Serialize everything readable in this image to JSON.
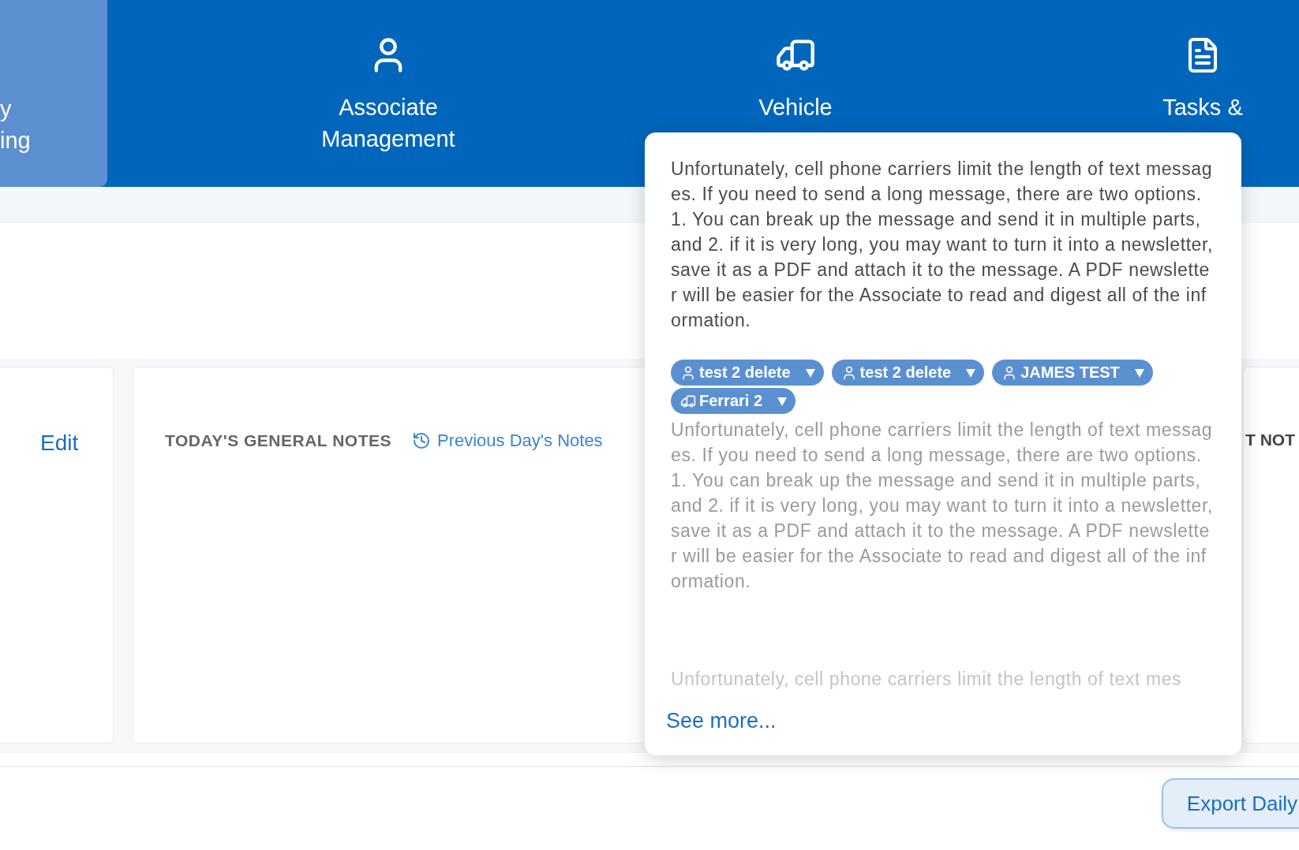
{
  "nav": {
    "tabs": [
      {
        "kind": "partial",
        "lines": [
          "y",
          "ing"
        ],
        "selected": true
      },
      {
        "kind": "associate",
        "lines": [
          "Associate",
          "Management"
        ],
        "selected": false
      },
      {
        "kind": "vehicle",
        "lines": [
          "Vehicle"
        ],
        "selected": false
      },
      {
        "kind": "tasks",
        "lines": [
          "Tasks &"
        ],
        "selected": false
      }
    ]
  },
  "left_card": {
    "edit_link": "Edit"
  },
  "general_notes_card": {
    "title": "TODAY'S GENERAL NOTES",
    "previous_link": "Previous Day's Notes"
  },
  "right_card": {
    "title_fragment": "T NOT"
  },
  "popover": {
    "entries": [
      {
        "kind": "dark",
        "text": "Unfortunately, cell phone carriers limit the length of text messages. If you need to send a long message, there are two options. 1. You can break up the message and send it in multiple parts, and 2. if it is very long, you may want to turn it into a newsletter, save it as a PDF and attach it to the message. A PDF newsletter will be easier for the Associate to read and digest all of the information."
      },
      {
        "kind": "muted",
        "tags": [
          {
            "kind": "associate",
            "label": "test 2 delete"
          },
          {
            "kind": "associate",
            "label": "test 2 delete"
          },
          {
            "kind": "associate",
            "label": "JAMES TEST"
          },
          {
            "kind": "vehicle",
            "label": "Ferrari 2"
          }
        ],
        "text": "Unfortunately, cell phone carriers limit the length of text messages. If you need to send a long message, there are two options. 1. You can break up the message and send it in multiple parts, and 2. if it is very long, you may want to turn it into a newsletter, save it as a PDF and attach it to the message. A PDF newsletter will be easier for the Associate to read and digest all of the information."
      },
      {
        "kind": "faint",
        "text": "Unfortunately, cell phone carriers limit the length of text mes"
      }
    ],
    "see_more": "See more..."
  },
  "footer": {
    "export_button": "Export Daily"
  }
}
